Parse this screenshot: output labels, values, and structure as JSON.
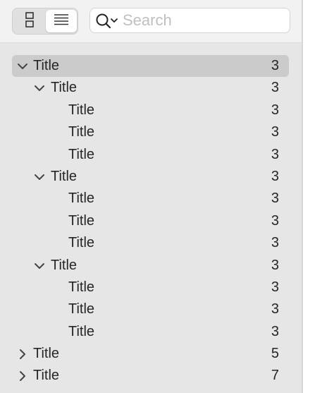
{
  "toolbar": {
    "view_toggle_left_icon": "column-view-icon",
    "view_toggle_right_icon": "list-view-icon",
    "search": {
      "placeholder": "Search",
      "value": "",
      "icon": "search-icon"
    }
  },
  "outline": {
    "rows": [
      {
        "label": "Title",
        "count": "3",
        "level": 0,
        "chevron": "down",
        "selected": true
      },
      {
        "label": "Title",
        "count": "3",
        "level": 1,
        "chevron": "down",
        "selected": false
      },
      {
        "label": "Title",
        "count": "3",
        "level": 2,
        "chevron": "none",
        "selected": false
      },
      {
        "label": "Title",
        "count": "3",
        "level": 2,
        "chevron": "none",
        "selected": false
      },
      {
        "label": "Title",
        "count": "3",
        "level": 2,
        "chevron": "none",
        "selected": false
      },
      {
        "label": "Title",
        "count": "3",
        "level": 1,
        "chevron": "down",
        "selected": false
      },
      {
        "label": "Title",
        "count": "3",
        "level": 2,
        "chevron": "none",
        "selected": false
      },
      {
        "label": "Title",
        "count": "3",
        "level": 2,
        "chevron": "none",
        "selected": false
      },
      {
        "label": "Title",
        "count": "3",
        "level": 2,
        "chevron": "none",
        "selected": false
      },
      {
        "label": "Title",
        "count": "3",
        "level": 1,
        "chevron": "down",
        "selected": false
      },
      {
        "label": "Title",
        "count": "3",
        "level": 2,
        "chevron": "none",
        "selected": false
      },
      {
        "label": "Title",
        "count": "3",
        "level": 2,
        "chevron": "none",
        "selected": false
      },
      {
        "label": "Title",
        "count": "3",
        "level": 2,
        "chevron": "none",
        "selected": false
      },
      {
        "label": "Title",
        "count": "5",
        "level": 0,
        "chevron": "right",
        "selected": false
      },
      {
        "label": "Title",
        "count": "7",
        "level": 0,
        "chevron": "right",
        "selected": false
      }
    ]
  },
  "colors": {
    "sidebar_bg": "#e6e6e6",
    "toolbar_bg": "#f2f2f2",
    "selection_bg": "#cbcbcb",
    "text": "#262626",
    "placeholder": "#c0c0c0"
  }
}
